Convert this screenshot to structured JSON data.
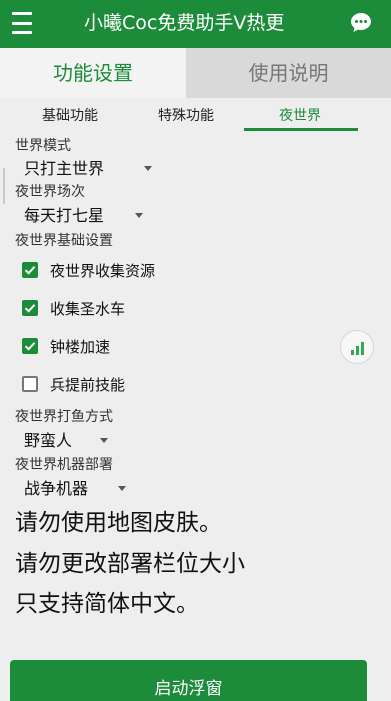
{
  "header": {
    "title": "小曦Coc免费助手V热更",
    "menu_icon": "menu-icon",
    "chat_icon": "chat-bubble-icon",
    "color": "#1c8c3b"
  },
  "main_tabs": [
    {
      "label": "功能设置",
      "active": true
    },
    {
      "label": "使用说明",
      "active": false
    }
  ],
  "sub_tabs": [
    {
      "label": "基础功能",
      "active": false
    },
    {
      "label": "特殊功能",
      "active": false
    },
    {
      "label": "夜世界",
      "active": true
    }
  ],
  "settings": {
    "world_mode": {
      "label": "世界模式",
      "value": "只打主世界"
    },
    "night_times": {
      "label": "夜世界场次",
      "value": "每天打七星"
    },
    "night_basic": {
      "label": "夜世界基础设置"
    },
    "checkboxes": [
      {
        "label": "夜世界收集资源",
        "checked": true
      },
      {
        "label": "收集圣水车",
        "checked": true
      },
      {
        "label": "钟楼加速",
        "checked": true
      },
      {
        "label": "兵提前技能",
        "checked": false
      }
    ],
    "fish_mode": {
      "label": "夜世界打鱼方式",
      "value": "野蛮人"
    },
    "machine_deploy": {
      "label": "夜世界机器部署",
      "value": "战争机器"
    }
  },
  "notices": [
    "请勿使用地图皮肤。",
    "请勿更改部署栏位大小",
    "只支持简体中文。"
  ],
  "floating_icon": "signal-bars-icon",
  "start_button": {
    "label": "启动浮窗"
  }
}
